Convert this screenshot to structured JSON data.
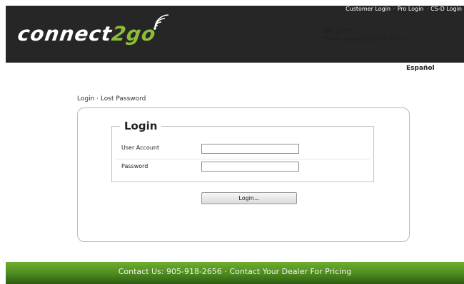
{
  "header": {
    "logo": {
      "text_main": "connect",
      "text_accent": "2go"
    },
    "top_links": [
      "Customer Login",
      "Pro Login",
      "CS-D Login"
    ],
    "separator": "·",
    "tagline": [
      "Be there,",
      "Even when you're not!"
    ]
  },
  "language_link": "Español",
  "breadcrumb": {
    "items": [
      "Login",
      "Lost Password"
    ],
    "separator": "·"
  },
  "login_form": {
    "legend": "Login",
    "user_account_label": "User Account",
    "user_account_value": "",
    "password_label": "Password",
    "password_value": "",
    "submit_label": "Login..."
  },
  "footer": {
    "text": "Contact Us: 905-918-2656 · Contact Your Dealer For Pricing"
  },
  "colors": {
    "header_bg": "#262626",
    "brand_green": "#8dbb3a",
    "footer_green": "#4b8a1f",
    "panel_border": "#b8b8b8"
  }
}
